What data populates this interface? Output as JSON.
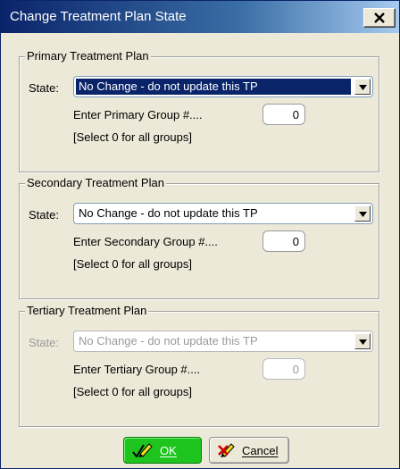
{
  "window": {
    "title": "Change Treatment Plan State"
  },
  "groups": [
    {
      "legend": "Primary Treatment Plan",
      "state_label": "State:",
      "state_value": "No Change - do not update this TP",
      "group_label": "Enter Primary Group #....",
      "group_value": "0",
      "hint": "[Select 0 for all groups]"
    },
    {
      "legend": "Secondary Treatment Plan",
      "state_label": "State:",
      "state_value": "No Change - do not update this TP",
      "group_label": "Enter Secondary Group #....",
      "group_value": "0",
      "hint": "[Select 0 for all groups]"
    },
    {
      "legend": "Tertiary Treatment Plan",
      "state_label": "State:",
      "state_value": "No Change - do not update this TP",
      "group_label": "Enter Tertiary Group #....",
      "group_value": "0",
      "hint": "[Select 0 for all groups]"
    }
  ],
  "buttons": {
    "ok_label": "OK",
    "cancel_label": "Cancel"
  },
  "colors": {
    "title_bar": "#0a246a",
    "selection": "#0a246a",
    "ok_button": "#1ec51e",
    "dialog_bg": "#ece9d8"
  }
}
